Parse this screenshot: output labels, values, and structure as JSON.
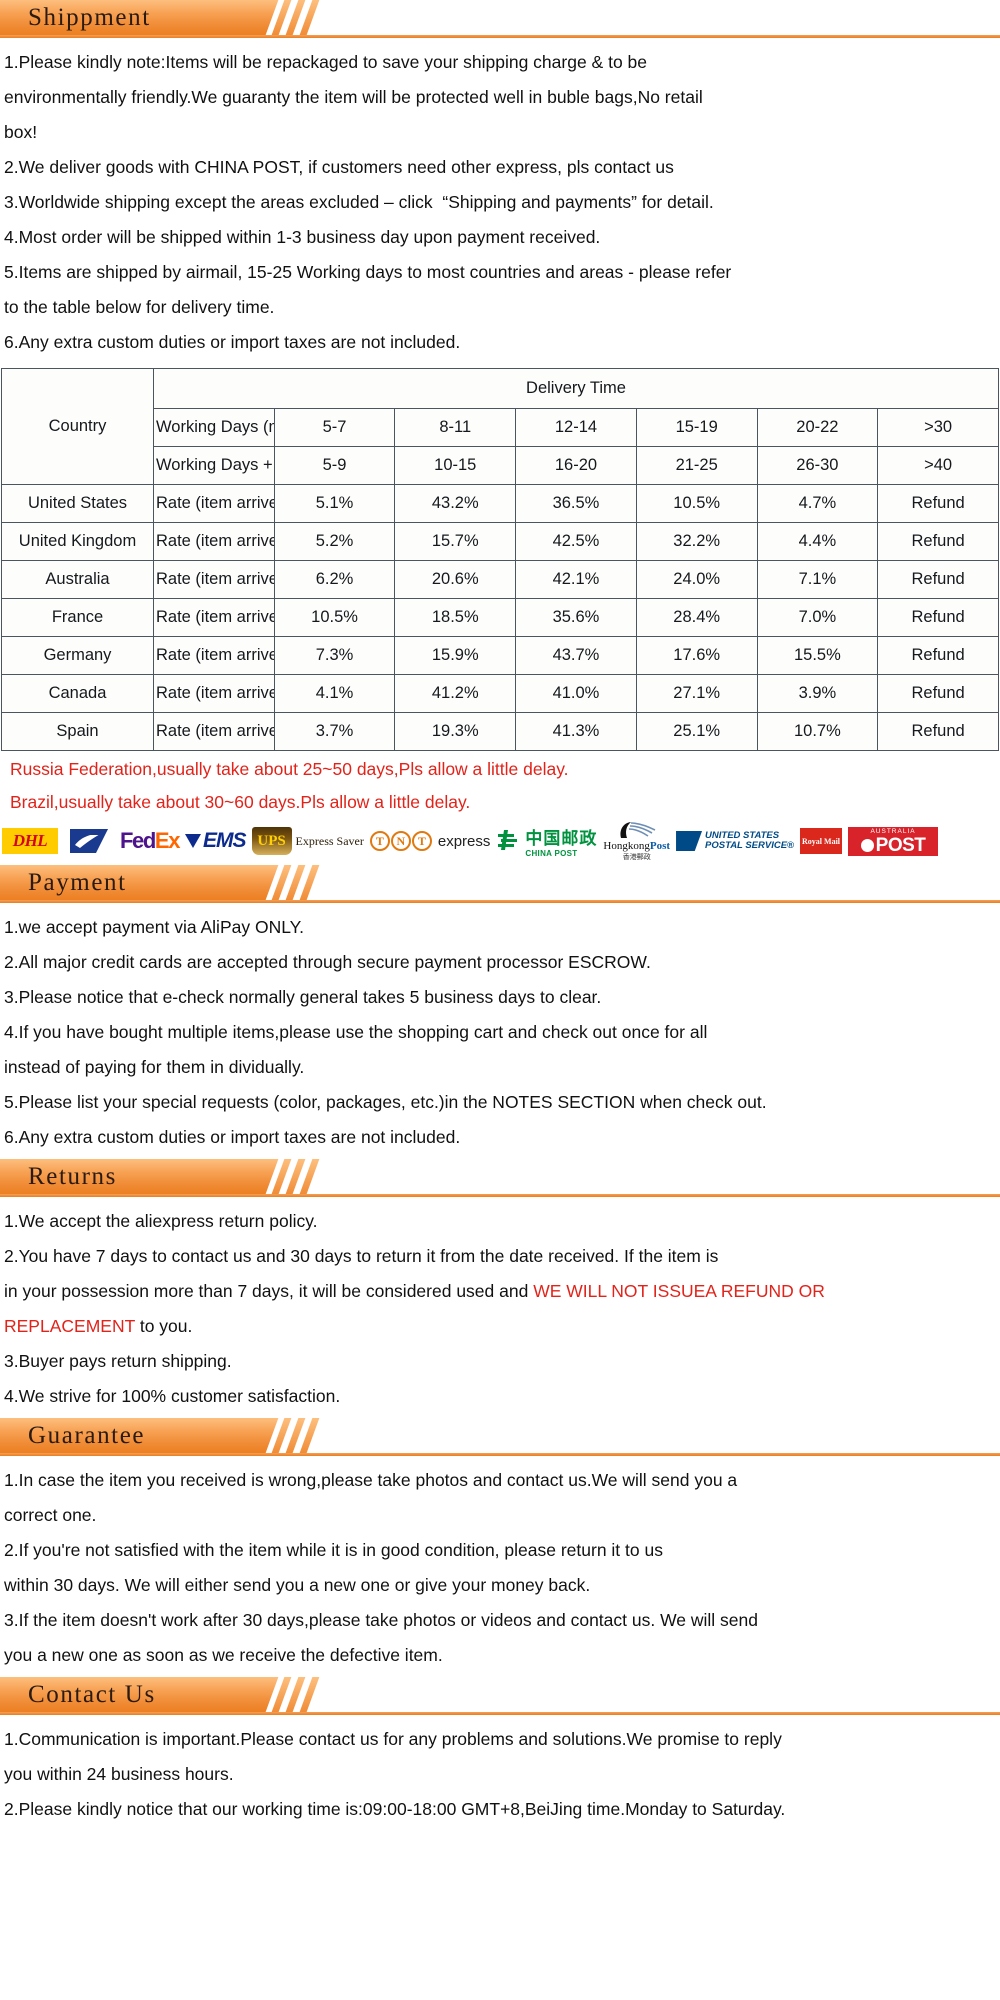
{
  "theme": {
    "accent": "#ee8a2e",
    "accent_dark": "#ea7d20",
    "red": "#e2231a",
    "text": "#111111",
    "table_border": "#4a5560"
  },
  "sections": [
    {
      "id": "shippment",
      "title": "Shippment",
      "lines": [
        "1.Please kindly note:Items will be repackaged to save your shipping charge & to be",
        "environmentally friendly.We guaranty the item will be protected well in buble bags,No retail",
        "box!",
        "2.We deliver goods with CHINA POST, if customers need other express, pls contact us",
        "3.Worldwide shipping except the areas excluded – click  “Shipping and payments” for detail.",
        "4.Most order will be shipped within 1-3 business day upon payment received.",
        "5.Items are shipped by airmail, 15-25 Working days to most countries and areas - please refer",
        "to the table below for delivery time.",
        "6.Any extra custom duties or import taxes are not included."
      ]
    },
    {
      "id": "payment",
      "title": "Payment",
      "lines": [
        "1.we accept payment via AliPay ONLY.",
        "2.All major credit cards are accepted through secure payment processor ESCROW.",
        "3.Please notice that e-check normally general takes 5 business days to clear.",
        "4.If you have bought multiple items,please use the shopping cart and check out once for all",
        "instead of paying for them in dividually.",
        "5.Please list your special requests (color, packages, etc.)in the NOTES SECTION when check out.",
        "6.Any extra custom duties or import taxes are not included."
      ]
    },
    {
      "id": "returns",
      "title": "Returns",
      "lines": [
        "1.We accept the aliexpress return policy.",
        "2.You have 7 days to contact us and 30 days to return it from the date received. If the item is",
        "in your possession more than 7 days, it will be considered used and ",
        "3.Buyer pays return shipping.",
        "4.We strive for 100% customer satisfaction."
      ],
      "highlight": {
        "red_part_1": "WE WILL NOT ISSUEA REFUND OR",
        "red_part_2": "REPLACEMENT",
        "tail": " to you."
      }
    },
    {
      "id": "guarantee",
      "title": "Guarantee",
      "lines": [
        "1.In case the item you received is wrong,please take photos and contact us.We will send you a",
        "correct one.",
        "2.If you're not satisfied with the item while it is in good condition, please return it to us",
        "within 30 days. We will either send you a new one or give your money back.",
        "3.If the item doesn't work after 30 days,please take photos or videos and contact us. We will send",
        "you a new one as soon as we receive the defective item."
      ]
    },
    {
      "id": "contact-us",
      "title": "Contact Us",
      "lines": [
        "1.Communication is important.Please contact us for any problems and solutions.We promise to reply",
        "you within 24 business hours.",
        "2.Please kindly notice that our working time is:09:00-18:00 GMT+8,BeiJing time.Monday to Saturday."
      ]
    }
  ],
  "delivery_table": {
    "country_header": "Country",
    "delivery_time_header": "Delivery Time",
    "row_headers": [
      "Working Days (not including holiday)",
      "Working Days + Saturday + Sunday"
    ],
    "rate_label": "Rate (item arrived)",
    "working_days": [
      "5-7",
      "8-11",
      "12-14",
      "15-19",
      "20-22",
      ">30"
    ],
    "working_days_with_weekend": [
      "5-9",
      "10-15",
      "16-20",
      "21-25",
      "26-30",
      ">40"
    ],
    "rows": [
      {
        "country": "United States",
        "rates": [
          "5.1%",
          "43.2%",
          "36.5%",
          "10.5%",
          "4.7%",
          "Refund"
        ]
      },
      {
        "country": "United Kingdom",
        "rates": [
          "5.2%",
          "15.7%",
          "42.5%",
          "32.2%",
          "4.4%",
          "Refund"
        ]
      },
      {
        "country": "Australia",
        "rates": [
          "6.2%",
          "20.6%",
          "42.1%",
          "24.0%",
          "7.1%",
          "Refund"
        ]
      },
      {
        "country": "France",
        "rates": [
          "10.5%",
          "18.5%",
          "35.6%",
          "28.4%",
          "7.0%",
          "Refund"
        ]
      },
      {
        "country": "Germany",
        "rates": [
          "7.3%",
          "15.9%",
          "43.7%",
          "17.6%",
          "15.5%",
          "Refund"
        ]
      },
      {
        "country": "Canada",
        "rates": [
          "4.1%",
          "41.2%",
          "41.0%",
          "27.1%",
          "3.9%",
          "Refund"
        ]
      },
      {
        "country": "Spain",
        "rates": [
          "3.7%",
          "19.3%",
          "41.3%",
          "25.1%",
          "10.7%",
          "Refund"
        ]
      }
    ]
  },
  "delay_notes": [
    "Russia Federation,usually take about 25~50 days,Pls allow a little delay.",
    "Brazil,usually take about 30~60 days.Pls allow a little delay."
  ],
  "carriers": [
    {
      "name": "dhl-logo",
      "label": "DHL"
    },
    {
      "name": "usps-eagle-logo",
      "label": "USPS"
    },
    {
      "name": "fedex-logo",
      "label_1": "Fed",
      "label_2": "Ex"
    },
    {
      "name": "ems-logo",
      "label": "EMS"
    },
    {
      "name": "ups-express-saver-logo",
      "label": "UPS",
      "sub": "Express Saver"
    },
    {
      "name": "tnt-logo",
      "label_1": "T",
      "label_2": "N",
      "label_3": "T"
    },
    {
      "name": "express-logo",
      "label": "express"
    },
    {
      "name": "china-post-logo",
      "label_cn": "中国邮政",
      "label_en": "CHINA POST"
    },
    {
      "name": "hongkong-post-logo",
      "label_1": "Hongkong",
      "label_2": "Post",
      "label_cn": "香港郵政"
    },
    {
      "name": "usps-logo",
      "label_1": "UNITED STATES",
      "label_2": "POSTAL SERVICE®"
    },
    {
      "name": "royal-mail-logo",
      "label": "Royal Mail"
    },
    {
      "name": "australia-post-logo",
      "label_top": "AUSTRALIA",
      "label_main": "POST"
    }
  ]
}
